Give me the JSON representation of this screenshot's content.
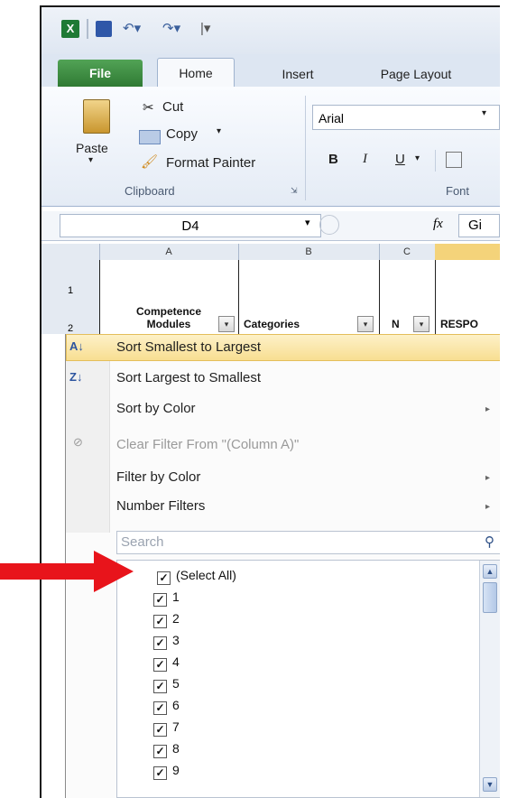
{
  "quick_access": {
    "excel_icon": "excel-icon",
    "save_icon": "save-icon",
    "undo_icon": "undo-icon",
    "redo_icon": "redo-icon",
    "customize_icon": "customize-qat-icon"
  },
  "tabs": [
    {
      "label": "File"
    },
    {
      "label": "Home"
    },
    {
      "label": "Insert"
    },
    {
      "label": "Page Layout"
    }
  ],
  "ribbon": {
    "paste_label": "Paste",
    "cut_label": "Cut",
    "copy_label": "Copy",
    "format_painter_label": "Format Painter",
    "clipboard_group": "Clipboard",
    "font_name": "Arial",
    "bold": "B",
    "italic": "I",
    "underline": "U",
    "font_group": "Font"
  },
  "formula_bar": {
    "name_box": "D4",
    "fx": "fx",
    "content": "Gi"
  },
  "sheet": {
    "columns": [
      "A",
      "B",
      "C"
    ],
    "rows": [
      "1",
      "2"
    ],
    "header_a": "Competence Modules",
    "header_b": "Categories",
    "header_c": "N",
    "header_d": "RESPO"
  },
  "filter_menu": {
    "items": [
      {
        "label": "Sort Smallest to Largest"
      },
      {
        "label": "Sort Largest to Smallest"
      },
      {
        "label": "Sort by Color"
      },
      {
        "label": "Clear Filter From \"(Column A)\""
      },
      {
        "label": "Filter by Color"
      },
      {
        "label": "Number Filters"
      }
    ],
    "search_placeholder": "Search",
    "list": [
      {
        "label": "(Select All)",
        "checked": true
      },
      {
        "label": "1",
        "checked": true
      },
      {
        "label": "2",
        "checked": true
      },
      {
        "label": "3",
        "checked": true
      },
      {
        "label": "4",
        "checked": true
      },
      {
        "label": "5",
        "checked": true
      },
      {
        "label": "6",
        "checked": true
      },
      {
        "label": "7",
        "checked": true
      },
      {
        "label": "8",
        "checked": true
      },
      {
        "label": "9",
        "checked": true
      }
    ]
  },
  "colors": {
    "file_tab": "#3b8a3f",
    "highlight": "#f8de91",
    "arrow": "#e8141b"
  }
}
